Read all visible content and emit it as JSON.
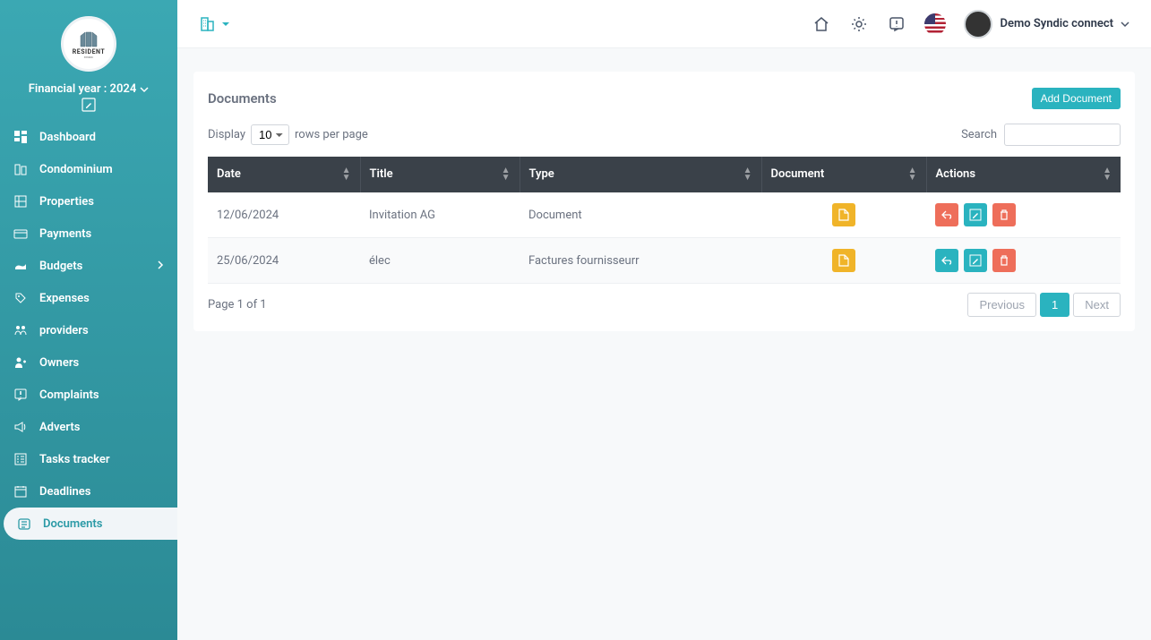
{
  "sidebar": {
    "logo_text": "RESIDENT",
    "logo_sub": "SYNDIC",
    "financial_year": "Financial year : 2024",
    "items": [
      {
        "label": "Dashboard",
        "active": false
      },
      {
        "label": "Condominium",
        "active": false
      },
      {
        "label": "Properties",
        "active": false
      },
      {
        "label": "Payments",
        "active": false
      },
      {
        "label": "Budgets",
        "active": false,
        "expandable": true
      },
      {
        "label": "Expenses",
        "active": false
      },
      {
        "label": "providers",
        "active": false
      },
      {
        "label": "Owners",
        "active": false
      },
      {
        "label": "Complaints",
        "active": false
      },
      {
        "label": "Adverts",
        "active": false
      },
      {
        "label": "Tasks tracker",
        "active": false
      },
      {
        "label": "Deadlines",
        "active": false
      },
      {
        "label": "Documents",
        "active": true
      }
    ]
  },
  "topbar": {
    "user_name": "Demo Syndic connect"
  },
  "documents": {
    "title": "Documents",
    "add_button": "Add Document",
    "display_label": "Display",
    "rows_per_page_label": "rows per page",
    "rows_value": "10",
    "search_label": "Search",
    "columns": {
      "date": "Date",
      "title": "Title",
      "type": "Type",
      "document": "Document",
      "actions": "Actions"
    },
    "rows": [
      {
        "date": "12/06/2024",
        "title": "Invitation AG",
        "type": "Document"
      },
      {
        "date": "25/06/2024",
        "title": "élec",
        "type": "Factures fournisseurr"
      }
    ],
    "page_info": "Page 1 of 1",
    "pagination": {
      "previous": "Previous",
      "page": "1",
      "next": "Next"
    }
  }
}
